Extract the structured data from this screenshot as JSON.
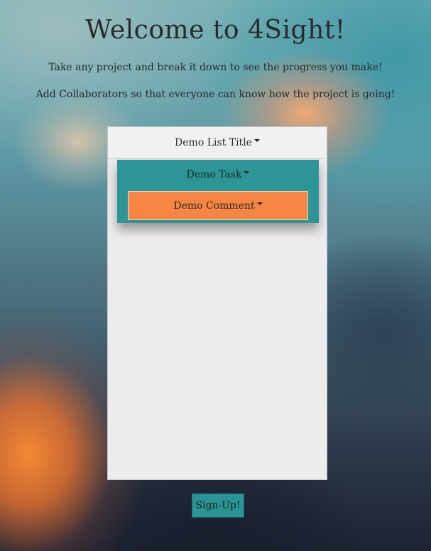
{
  "header": {
    "title": "Welcome to 4Sight!",
    "tagline_1": "Take any project and break it down to see the progress you make!",
    "tagline_2": "Add Collaborators so that everyone can know how the project is going!"
  },
  "demo": {
    "list_title": "Demo List Title",
    "task_title": "Demo Task",
    "comment_title": "Demo Comment"
  },
  "actions": {
    "signup_label": "Sign-Up!"
  },
  "colors": {
    "task_bg": "#2c9595",
    "comment_bg": "#f68542",
    "signup_bg": "#2a9594",
    "list_bg": "#ececec"
  },
  "icons": {
    "dropdown": "caret-down-icon"
  }
}
